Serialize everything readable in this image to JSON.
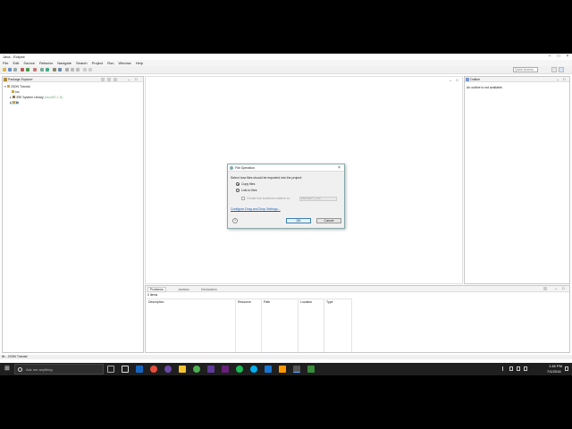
{
  "window": {
    "title": "Java - Eclipse"
  },
  "menu": [
    "File",
    "Edit",
    "Source",
    "Refactor",
    "Navigate",
    "Search",
    "Project",
    "Run",
    "Window",
    "Help"
  ],
  "toolbar": {
    "quick_access_placeholder": "Quick Access"
  },
  "package_explorer": {
    "tab_label": "Package Explorer",
    "tree": [
      {
        "label": "JSON Tutorial",
        "level": 0
      },
      {
        "label": "src",
        "level": 1
      },
      {
        "label": "JRE System Library",
        "suffix": "[JavaSE-1.8]",
        "level": 1
      },
      {
        "label": "lib",
        "level": 1
      }
    ]
  },
  "outline": {
    "tab_label": "Outline",
    "message": "An outline is not available."
  },
  "dialog": {
    "title": "File Operation",
    "prompt": "Select how files should be imported into the project:",
    "option_copy": "Copy files",
    "option_link": "Link to files",
    "create_link_label": "Create link locations relative to:",
    "relative_value": "PROJECT_LOC",
    "configure_link": "Configure Drag and Drop Settings...",
    "ok": "OK",
    "cancel": "Cancel",
    "help": "?"
  },
  "bottom_panel": {
    "tabs": [
      "Problems",
      "Javadoc",
      "Declaration"
    ],
    "count": "0 items",
    "columns": [
      "Description",
      "Resource",
      "Path",
      "Location",
      "Type"
    ]
  },
  "status": {
    "text": "lib - JSON Tutorial"
  },
  "taskbar": {
    "search_placeholder": "Ask me anything",
    "time": "1:46 PM",
    "date": "7/1/2016",
    "colors": {
      "background": "#1f1f1f",
      "accent": "#3c7fb1"
    }
  }
}
